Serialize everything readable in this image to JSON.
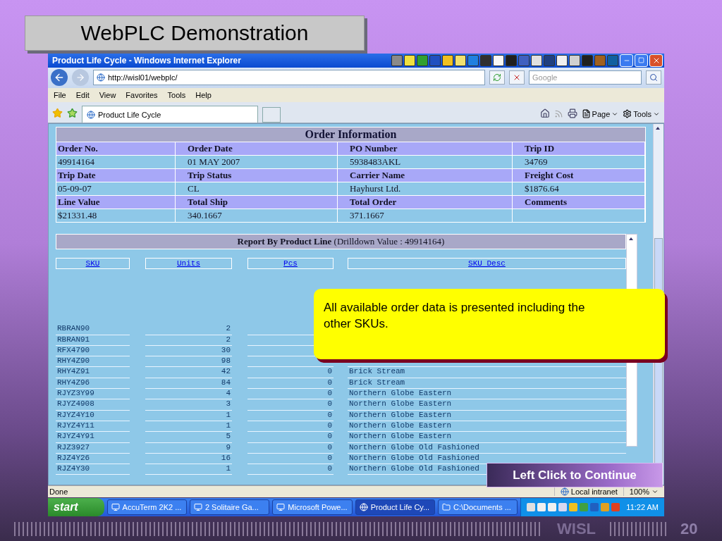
{
  "slide": {
    "title": "WebPLC Demonstration",
    "brand": "WISL",
    "page_number": "20"
  },
  "window": {
    "title": "Product Life Cycle - Windows Internet Explorer"
  },
  "address_bar": {
    "url": "http://wisl01/webplc/"
  },
  "search": {
    "placeholder": "Google"
  },
  "menu": [
    "File",
    "Edit",
    "View",
    "Favorites",
    "Tools",
    "Help"
  ],
  "tabs": [
    {
      "label": "Product Life Cycle",
      "selected": true
    }
  ],
  "command_bar": [
    {
      "label": "Page"
    },
    {
      "label": "Tools"
    }
  ],
  "order_info": {
    "title": "Order Information",
    "fields": [
      {
        "label": "Order No.",
        "value": "49914164"
      },
      {
        "label": "Order Date",
        "value": "01 MAY 2007"
      },
      {
        "label": "PO Number",
        "value": "5938483AKL"
      },
      {
        "label": "Trip ID",
        "value": "34769"
      },
      {
        "label": "Trip Date",
        "value": "05-09-07"
      },
      {
        "label": "Trip Status",
        "value": "CL"
      },
      {
        "label": "Carrier Name",
        "value": "Hayhurst Ltd."
      },
      {
        "label": "Freight Cost",
        "value": "$1876.64"
      },
      {
        "label": "Line Value",
        "value": "$21331.48"
      },
      {
        "label": "Total Ship",
        "value": "340.1667"
      },
      {
        "label": "Total Order",
        "value": "371.1667"
      },
      {
        "label": "Comments"
      }
    ]
  },
  "report": {
    "title": "**Report By Product Line** (Drilldown Value : 49914164)",
    "columns": [
      "SKU",
      "Units",
      "Pcs",
      "SKU Desc"
    ],
    "rows": [
      {
        "sku": "RBRAN90",
        "units": "2"
      },
      {
        "sku": "RBRAN91",
        "units": "2"
      },
      {
        "sku": "RFX4790",
        "units": "30"
      },
      {
        "sku": "RHY4Z90",
        "units": "98"
      },
      {
        "sku": "RHY4Z91",
        "units": "42",
        "pcs": "0",
        "desc": "Brick Stream"
      },
      {
        "sku": "RHY4Z96",
        "units": "84",
        "pcs": "0",
        "desc": "Brick Stream"
      },
      {
        "sku": "RJYZ3Y99",
        "units": "4",
        "pcs": "0",
        "desc": "Northern Globe Eastern"
      },
      {
        "sku": "RJYZ4908",
        "units": "3",
        "pcs": "0",
        "desc": "Northern Globe Eastern"
      },
      {
        "sku": "RJYZ4Y10",
        "units": "1",
        "pcs": "0",
        "desc": "Northern Globe Eastern"
      },
      {
        "sku": "RJYZ4Y11",
        "units": "1",
        "pcs": "0",
        "desc": "Northern Globe Eastern"
      },
      {
        "sku": "RJYZ4Y91",
        "units": "5",
        "pcs": "0",
        "desc": "Northern Globe Eastern"
      },
      {
        "sku": "RJZ3927",
        "units": "9",
        "pcs": "0",
        "desc": "Northern Globe Old Fashioned"
      },
      {
        "sku": "RJZ4Y26",
        "units": "16",
        "pcs": "0",
        "desc": "Northern Globe Old Fashioned"
      },
      {
        "sku": "RJZ4Y30",
        "units": "1",
        "pcs": "0",
        "desc": "Northern Globe Old Fashioned"
      }
    ]
  },
  "callout": {
    "text": "All available order data is presented including the other SKUs."
  },
  "continue_button": {
    "label": "Left Click to Continue"
  },
  "status_bar": {
    "status": "Done",
    "zone": "Local intranet",
    "zoom": "100%"
  },
  "taskbar": {
    "start": "start",
    "items": [
      {
        "label": "AccuTerm 2K2 ...",
        "selected": false
      },
      {
        "label": "2 Solitaire Ga...",
        "selected": false
      },
      {
        "label": "Microsoft Powe...",
        "selected": false
      },
      {
        "label": "Product Life Cy...",
        "selected": true
      },
      {
        "label": "C:\\Documents ...",
        "selected": false
      }
    ],
    "clock": "11:22 AM"
  }
}
